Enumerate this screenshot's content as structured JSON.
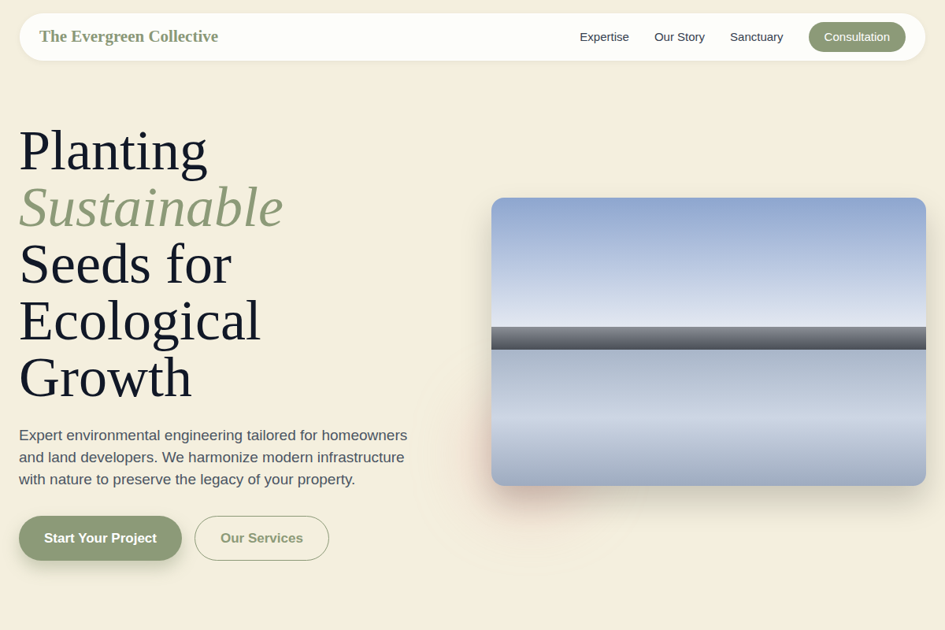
{
  "header": {
    "logo": "The Evergreen Collective",
    "nav": [
      "Expertise",
      "Our Story",
      "Sanctuary"
    ],
    "cta": "Consultation"
  },
  "hero": {
    "title_lines": [
      {
        "text": "Planting",
        "accent": false
      },
      {
        "text": "Sustainable",
        "accent": true
      },
      {
        "text": "Seeds for",
        "accent": false
      },
      {
        "text": "Ecological",
        "accent": false
      },
      {
        "text": "Growth",
        "accent": false
      }
    ],
    "description": "Expert environmental engineering tailored for homeowners and land developers. We harmonize modern infrastructure with nature to preserve the legacy of your property.",
    "buttons": [
      {
        "label": "Start Your Project",
        "kind": "primary"
      },
      {
        "label": "Our Services",
        "kind": "secondary"
      }
    ]
  }
}
